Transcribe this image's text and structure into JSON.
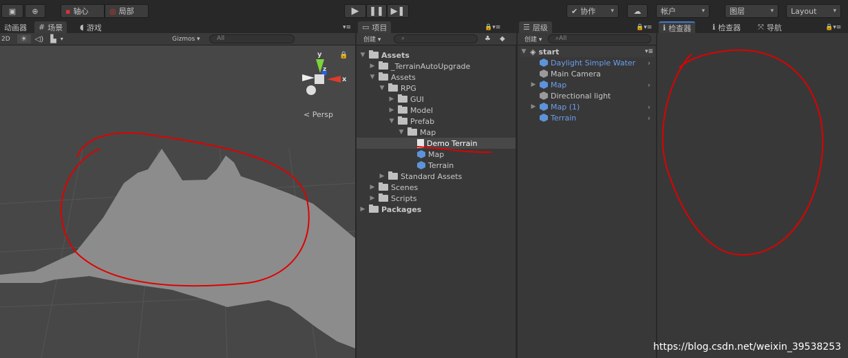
{
  "toolbar": {
    "pivot": "轴心",
    "local": "局部",
    "collab": "协作",
    "account": "帐户",
    "layers": "图层",
    "layout": "Layout"
  },
  "scene": {
    "tabs": [
      "动画器",
      "场景",
      "游戏"
    ],
    "mode_2d": "2D",
    "gizmos": "Gizmos",
    "search_placeholder": "All",
    "persp": "Persp",
    "axis_y": "y",
    "axis_x": "x",
    "axis_z": "z"
  },
  "project": {
    "tab": "项目",
    "create": "创建",
    "items": [
      {
        "label": "Assets",
        "depth": 0,
        "icon": "folder",
        "expanded": true,
        "bold": true
      },
      {
        "label": "_TerrainAutoUpgrade",
        "depth": 1,
        "icon": "folder",
        "expanded": false
      },
      {
        "label": "Assets",
        "depth": 1,
        "icon": "folder",
        "expanded": true
      },
      {
        "label": "RPG",
        "depth": 2,
        "icon": "folder",
        "expanded": true
      },
      {
        "label": "GUI",
        "depth": 3,
        "icon": "folder",
        "expanded": false
      },
      {
        "label": "Model",
        "depth": 3,
        "icon": "folder",
        "expanded": false
      },
      {
        "label": "Prefab",
        "depth": 3,
        "icon": "folder",
        "expanded": true
      },
      {
        "label": "Map",
        "depth": 4,
        "icon": "folder",
        "expanded": true
      },
      {
        "label": "Demo Terrain",
        "depth": 5,
        "icon": "file",
        "selected": true
      },
      {
        "label": "Map",
        "depth": 5,
        "icon": "prefab"
      },
      {
        "label": "Terrain",
        "depth": 5,
        "icon": "prefab"
      },
      {
        "label": "Standard Assets",
        "depth": 2,
        "icon": "folder",
        "expanded": false
      },
      {
        "label": "Scenes",
        "depth": 1,
        "icon": "folder",
        "expanded": false
      },
      {
        "label": "Scripts",
        "depth": 1,
        "icon": "folder",
        "expanded": false
      },
      {
        "label": "Packages",
        "depth": 0,
        "icon": "folder",
        "expanded": false,
        "bold": true
      }
    ]
  },
  "hierarchy": {
    "tab": "层级",
    "create": "创建",
    "search_placeholder": "All",
    "scene": "start",
    "items": [
      {
        "label": "Daylight Simple Water",
        "prefab": true,
        "arrow": false
      },
      {
        "label": "Main Camera",
        "prefab": false,
        "arrow": false
      },
      {
        "label": "Map",
        "prefab": true,
        "arrow": true
      },
      {
        "label": "Directional light",
        "prefab": false,
        "arrow": false
      },
      {
        "label": "Map (1)",
        "prefab": true,
        "arrow": true
      },
      {
        "label": "Terrain",
        "prefab": true,
        "arrow": false
      }
    ]
  },
  "inspector": {
    "tabs": [
      "检查器",
      "检查器",
      "导航"
    ]
  },
  "watermark": "https://blog.csdn.net/weixin_39538253",
  "colors": {
    "annotation": "#e00000",
    "prefab_text": "#6c9ef0",
    "accent_tab": "#3d7bd0"
  }
}
